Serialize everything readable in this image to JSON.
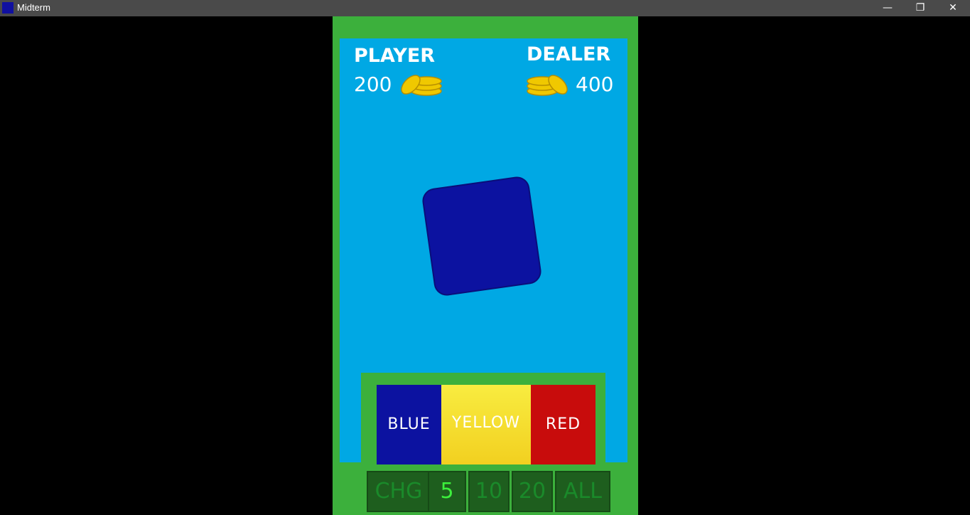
{
  "window": {
    "title": "Midterm",
    "minimize_glyph": "—",
    "restore_glyph": "❐",
    "close_glyph": "✕"
  },
  "colors": {
    "game_bg": "#3cb03c",
    "board_bg": "#00a8e4",
    "card": "#0c12a0",
    "coin": "#f0c800"
  },
  "player": {
    "label": "PLAYER",
    "coins": "200"
  },
  "dealer": {
    "label": "DEALER",
    "coins": "400"
  },
  "card": {
    "color": "blue"
  },
  "choices": [
    {
      "label": "BLUE"
    },
    {
      "label": "YELLOW"
    },
    {
      "label": "RED"
    }
  ],
  "bets": [
    {
      "label": "CHG",
      "active": false
    },
    {
      "label": "5",
      "active": true
    },
    {
      "label": "10",
      "active": false
    },
    {
      "label": "20",
      "active": false
    },
    {
      "label": "ALL",
      "active": false
    }
  ]
}
